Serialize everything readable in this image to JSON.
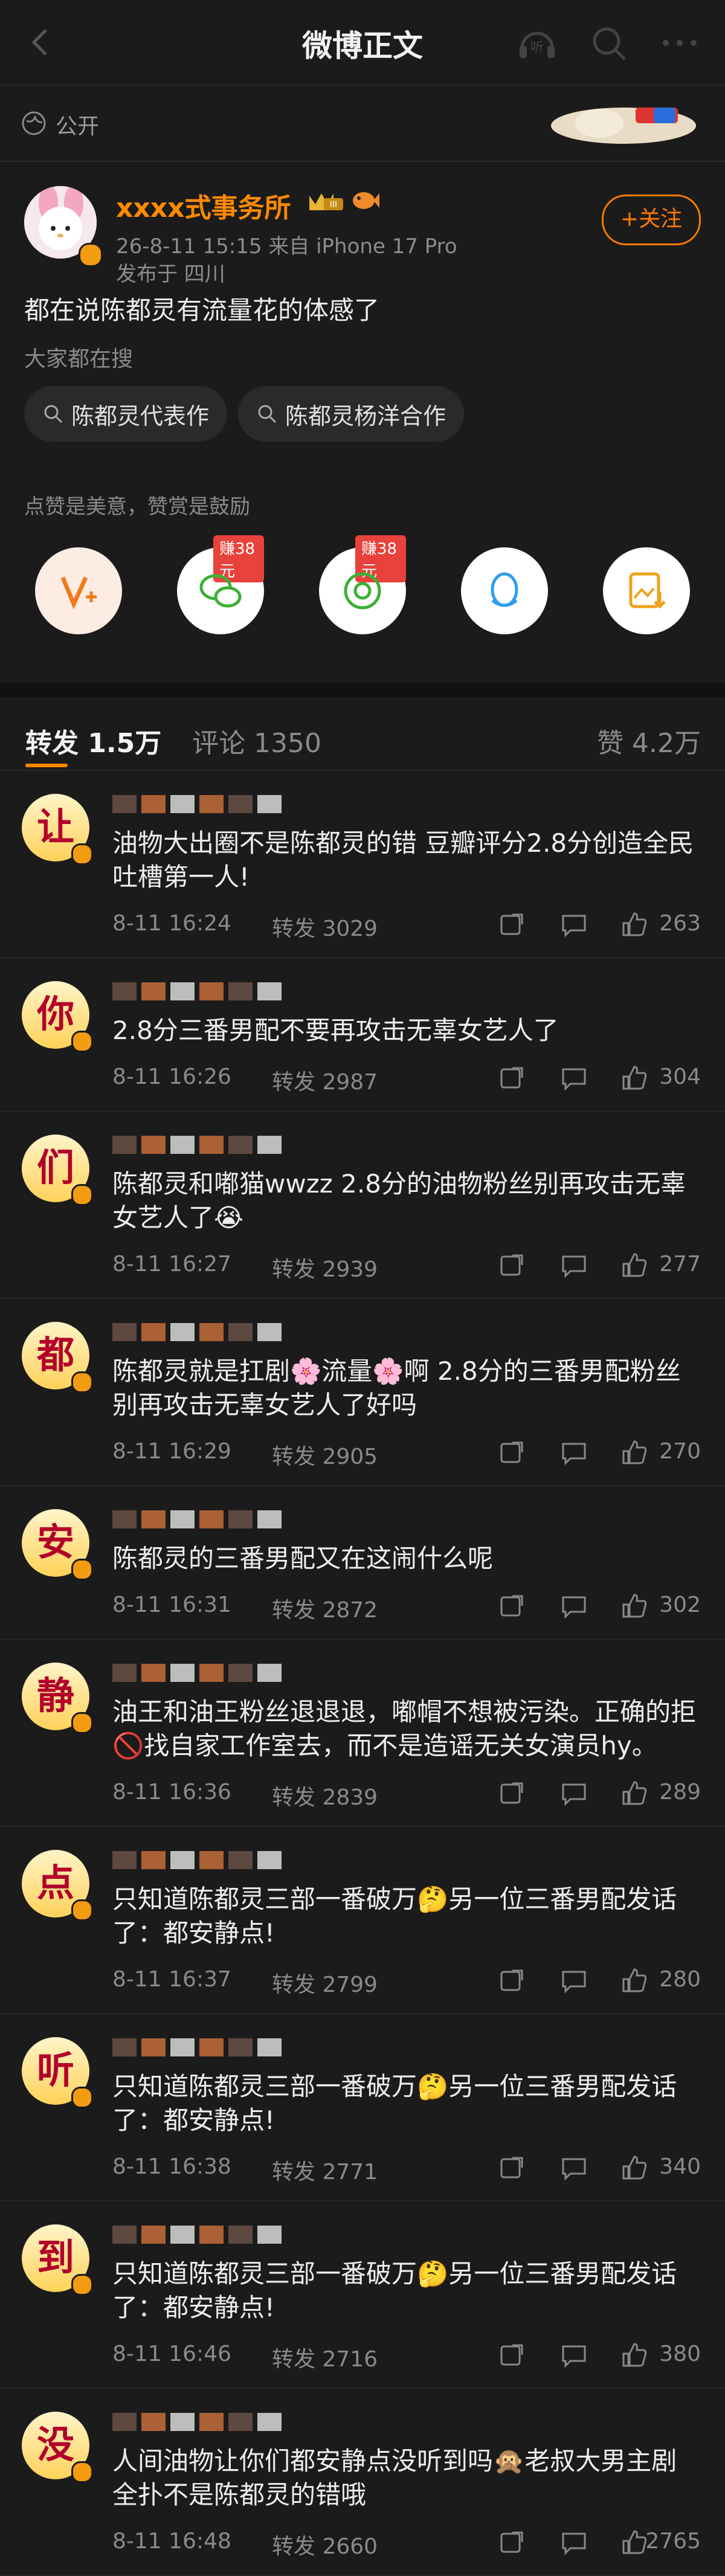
{
  "nav": {
    "title": "微博正文",
    "listen_label": "听"
  },
  "visibility": {
    "label": "公开"
  },
  "post": {
    "author": "xxxx式事务所",
    "time_source": "26-8-11 15:15  来自 iPhone 17 Pro",
    "location": "发布于 四川",
    "follow_label": "+关注",
    "crown_level": "III",
    "text": "都在说陈都灵有流量花的体感了",
    "search_title": "大家都在搜",
    "chips": [
      "陈都灵代表作",
      "陈都灵杨洋合作"
    ]
  },
  "reward": {
    "hint": "点赞是美意，赞赏是鼓励",
    "share_items": [
      {
        "icon": "v-plus-icon",
        "badge": ""
      },
      {
        "icon": "wechat-icon",
        "badge": "赚38元"
      },
      {
        "icon": "moments-icon",
        "badge": "赚38元"
      },
      {
        "icon": "qq-icon",
        "badge": ""
      },
      {
        "icon": "save-image-icon",
        "badge": ""
      }
    ]
  },
  "tabs": {
    "reposts": "转发 1.5万",
    "comments": "评论 1350",
    "likes": "赞 4.2万"
  },
  "reposts": [
    {
      "avatar_char": "让",
      "text": "油物大出圈不是陈都灵的错  豆瓣评分2.8分创造全民吐槽第一人!",
      "time": "8-11 16:24",
      "forward": "转发 3029",
      "likes": "263"
    },
    {
      "avatar_char": "你",
      "text": "2.8分三番男配不要再攻击无辜女艺人了",
      "time": "8-11 16:26",
      "forward": "转发 2987",
      "likes": "304"
    },
    {
      "avatar_char": "们",
      "text": "陈都灵和嘟猫wwzz  2.8分的油物粉丝别再攻击无辜女艺人了😭",
      "time": "8-11 16:27",
      "forward": "转发 2939",
      "likes": "277"
    },
    {
      "avatar_char": "都",
      "text": "陈都灵就是扛剧🌸流量🌸啊 2.8分的三番男配粉丝别再攻击无辜女艺人了好吗",
      "time": "8-11 16:29",
      "forward": "转发 2905",
      "likes": "270"
    },
    {
      "avatar_char": "安",
      "text": "陈都灵的三番男配又在这闹什么呢",
      "time": "8-11 16:31",
      "forward": "转发 2872",
      "likes": "302"
    },
    {
      "avatar_char": "静",
      "text": "油王和油王粉丝退退退，嘟帽不想被污染。正确的拒🚫找自家工作室去，而不是造谣无关女演员hy。",
      "time": "8-11 16:36",
      "forward": "转发 2839",
      "likes": "289"
    },
    {
      "avatar_char": "点",
      "text": "只知道陈都灵三部一番破万🤔另一位三番男配发话了：都安静点!",
      "time": "8-11 16:37",
      "forward": "转发 2799",
      "likes": "280"
    },
    {
      "avatar_char": "听",
      "text": "只知道陈都灵三部一番破万🤔另一位三番男配发话了：都安静点!",
      "time": "8-11 16:38",
      "forward": "转发 2771",
      "likes": "340"
    },
    {
      "avatar_char": "到",
      "text": "只知道陈都灵三部一番破万🤔另一位三番男配发话了：都安静点!",
      "time": "8-11 16:46",
      "forward": "转发 2716",
      "likes": "380"
    },
    {
      "avatar_char": "没",
      "text": "人间油物让你们都安静点没听到吗🙊老叔大男主剧全扑不是陈都灵的错哦",
      "time": "8-11 16:48",
      "forward": "转发 2660",
      "likes": "2765"
    }
  ]
}
